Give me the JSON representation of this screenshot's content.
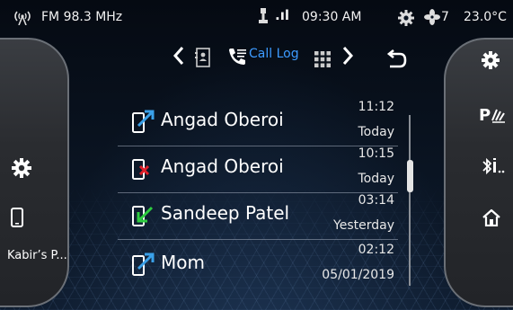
{
  "status_bar": {
    "radio_label": "FM 98.3 MHz",
    "signal_label": ".ıl",
    "time": "09:30 AM",
    "fan_speed": "7",
    "temperature": "23.0°C"
  },
  "nav": {
    "title": "Call Log"
  },
  "left_panel": {
    "device_label": "Kabir’s P..."
  },
  "call_log": [
    {
      "name": "Angad Oberoi",
      "time": "11:12",
      "day": "Today",
      "type": "outgoing",
      "icon": "outgoing-call-icon"
    },
    {
      "name": "Angad Oberoi",
      "time": "10:15",
      "day": "Today",
      "type": "missed",
      "icon": "missed-call-icon"
    },
    {
      "name": "Sandeep Patel",
      "time": "03:14",
      "day": "Yesterday",
      "type": "incoming",
      "icon": "incoming-call-icon"
    },
    {
      "name": "Mom",
      "time": "02:12",
      "day": "05/01/2019",
      "type": "outgoing",
      "icon": "outgoing-call-icon"
    }
  ],
  "colors": {
    "accent": "#3d9bff",
    "outgoing": "#3aa0e8",
    "missed": "#e0202a",
    "incoming": "#2ecc40"
  }
}
